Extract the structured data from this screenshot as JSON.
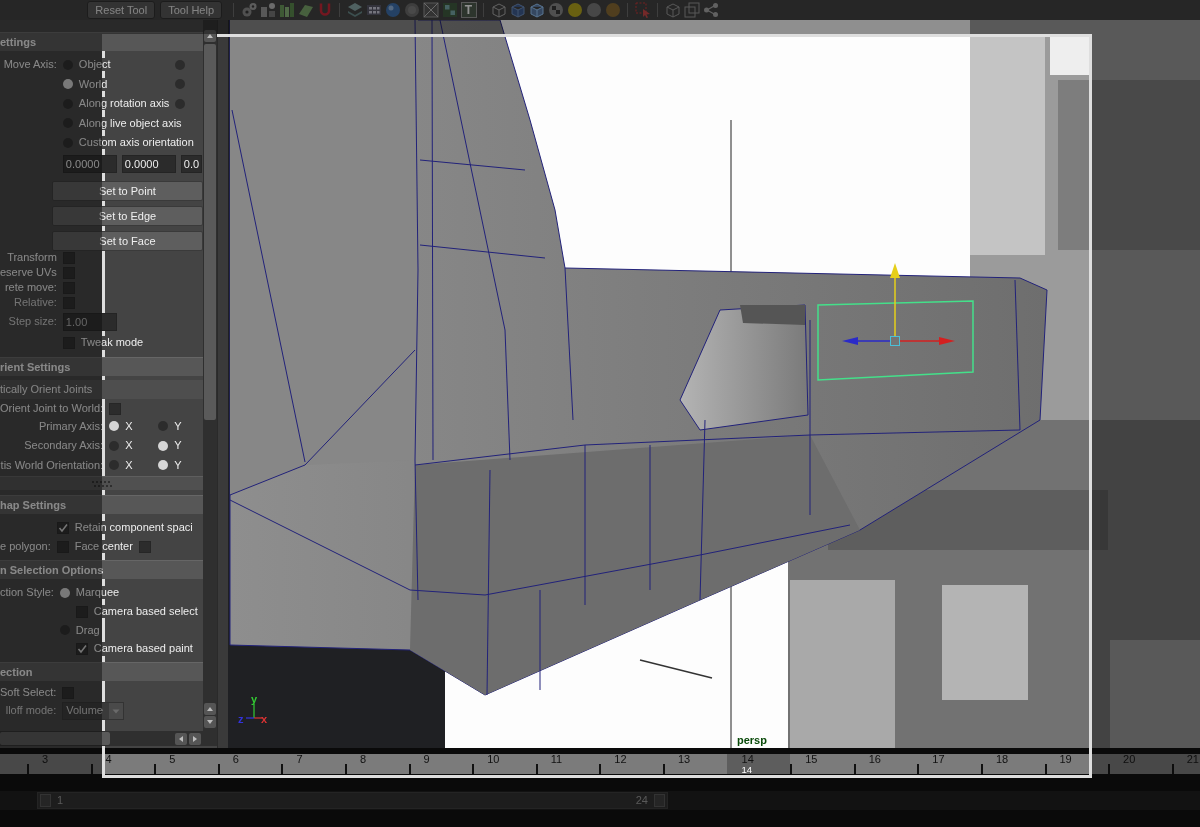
{
  "top_bar": {
    "buttons": [
      {
        "label": "Reset Tool"
      },
      {
        "label": "Tool Help"
      }
    ],
    "text_tool_glyph": "T"
  },
  "tool_settings": {
    "sections": [
      {
        "header": "ettings",
        "rows": [
          {
            "kind": "radio",
            "label": "Move Axis:",
            "disabled": false,
            "options": [
              {
                "text": "Object",
                "selected": false
              },
              {
                "selected": false
              }
            ]
          },
          {
            "kind": "radio",
            "disabled": false,
            "options": [
              {
                "text": "World",
                "selected": true
              },
              {
                "selected": false
              }
            ]
          },
          {
            "kind": "radio",
            "disabled": false,
            "options": [
              {
                "text": "Along rotation axis",
                "selected": false
              },
              {
                "selected": false
              }
            ]
          },
          {
            "kind": "radio",
            "disabled": false,
            "options": [
              {
                "text": "Along live object axis",
                "selected": false
              }
            ]
          },
          {
            "kind": "radio",
            "disabled": false,
            "options": [
              {
                "text": "Custom axis orientation",
                "selected": false
              }
            ]
          },
          {
            "kind": "fields",
            "disabled": false,
            "values": [
              "0.0000",
              "0.0000",
              "0.0"
            ]
          },
          {
            "kind": "button",
            "text": "Set to Point"
          },
          {
            "kind": "button",
            "text": "Set to Edge"
          },
          {
            "kind": "button",
            "text": "Set to Face"
          },
          {
            "kind": "check",
            "label": "Transform",
            "disabled": false,
            "options": [
              {
                "checked": false
              }
            ]
          },
          {
            "kind": "check",
            "label": "eserve UVs",
            "disabled": false,
            "options": [
              {
                "checked": false
              }
            ]
          },
          {
            "kind": "check",
            "label": "rete move:",
            "disabled": false,
            "options": [
              {
                "checked": false
              }
            ]
          },
          {
            "kind": "check",
            "label": "Relative:",
            "disabled": true,
            "options": [
              {
                "checked": false
              }
            ]
          },
          {
            "kind": "fields",
            "label": "Step size:",
            "disabled": true,
            "values": [
              "1.00"
            ]
          },
          {
            "kind": "check",
            "disabled": false,
            "options": [
              {
                "text": "Tweak mode",
                "checked": false
              }
            ]
          }
        ]
      },
      {
        "header": "rient Settings",
        "rows": [
          {
            "kind": "subheader",
            "text": "tically Orient Joints"
          },
          {
            "kind": "check",
            "label": "Orient Joint to World:",
            "disabled": false,
            "options": [
              {
                "checked": false
              }
            ]
          },
          {
            "kind": "radio",
            "label": "Primary Axis:",
            "disabled": false,
            "options": [
              {
                "text": "X",
                "selected": true
              },
              {
                "text": "Y",
                "selected": false
              }
            ]
          },
          {
            "kind": "radio",
            "label": "Secondary Axis:",
            "disabled": false,
            "options": [
              {
                "text": "X",
                "selected": false
              },
              {
                "text": "Y",
                "selected": true
              }
            ]
          },
          {
            "kind": "radio",
            "label": "tis World Orientation:",
            "disabled": false,
            "options": [
              {
                "text": "X",
                "selected": false
              },
              {
                "text": "Y",
                "selected": true
              }
            ]
          },
          {
            "kind": "grip"
          }
        ]
      },
      {
        "header": "hap Settings",
        "rows": [
          {
            "kind": "check",
            "disabled": false,
            "options": [
              {
                "text": "Retain component spaci",
                "checked": true
              }
            ]
          },
          {
            "kind": "check",
            "label": "e polygon:",
            "disabled": false,
            "options": [
              {
                "text": "Face center",
                "checked": false
              },
              {
                "checked": false
              }
            ]
          }
        ]
      },
      {
        "header": "n Selection Options",
        "rows": [
          {
            "kind": "radio",
            "label": "ction Style:",
            "disabled": false,
            "options": [
              {
                "text": "Marquee",
                "selected": true,
                "children": [
                  {
                    "text": "Camera based select",
                    "checked": false
                  }
                ]
              }
            ]
          },
          {
            "kind": "radio",
            "disabled": false,
            "options": [
              {
                "text": "Drag",
                "selected": false,
                "children": [
                  {
                    "text": "Camera based paint",
                    "checked": true
                  }
                ]
              }
            ]
          }
        ]
      },
      {
        "header": "ection",
        "rows": [
          {
            "kind": "check",
            "label": "Soft Select:",
            "disabled": false,
            "options": [
              {
                "checked": false
              }
            ]
          },
          {
            "kind": "dropdown",
            "label": "lloff mode:",
            "disabled": true,
            "value": "Volume"
          }
        ]
      }
    ]
  },
  "viewport": {
    "axis_labels": [
      "y",
      "z",
      "x"
    ],
    "camera_label": "persp"
  },
  "timeline": {
    "frames": [
      {
        "label": "3",
        "selected": false
      },
      {
        "label": "4",
        "selected": false
      },
      {
        "label": "5",
        "selected": false
      },
      {
        "label": "6",
        "selected": false
      },
      {
        "label": "7",
        "selected": false
      },
      {
        "label": "8",
        "selected": false
      },
      {
        "label": "9",
        "selected": false
      },
      {
        "label": "10",
        "selected": false
      },
      {
        "label": "11",
        "selected": false
      },
      {
        "label": "12",
        "selected": false
      },
      {
        "label": "13",
        "selected": false
      },
      {
        "label": "14",
        "selected": true
      },
      {
        "label": "15",
        "selected": false
      },
      {
        "label": "16",
        "selected": false
      },
      {
        "label": "17",
        "selected": false
      },
      {
        "label": "18",
        "selected": false
      },
      {
        "label": "19",
        "selected": false
      },
      {
        "label": "20",
        "selected": false
      },
      {
        "label": "21",
        "selected": false
      }
    ],
    "current_frame": "14"
  },
  "range_slider": {
    "start": "1",
    "end": "24"
  }
}
